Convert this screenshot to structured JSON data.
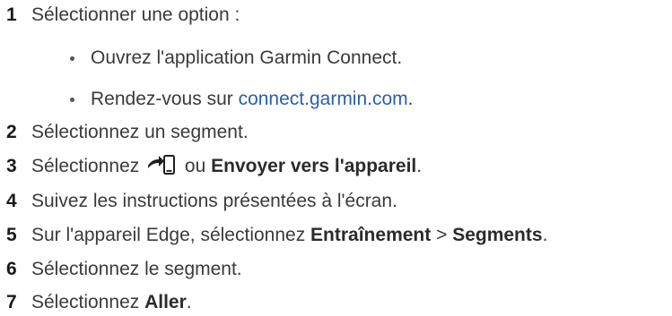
{
  "steps": {
    "s1": {
      "number": "1",
      "text": "Sélectionner une option :"
    },
    "b1": {
      "text": "Ouvrez l'application Garmin Connect."
    },
    "b2": {
      "prefix": "Rendez-vous sur ",
      "link": "connect.garmin.com",
      "suffix": "."
    },
    "s2": {
      "number": "2",
      "text": "Sélectionnez un segment."
    },
    "s3": {
      "number": "3",
      "prefix": "Sélectionnez ",
      "middle": " ou ",
      "bold": "Envoyer vers l'appareil",
      "suffix": ".",
      "icon": "send-to-device-icon"
    },
    "s4": {
      "number": "4",
      "text": "Suivez les instructions présentées à l'écran."
    },
    "s5": {
      "number": "5",
      "prefix": "Sur l'appareil Edge, sélectionnez ",
      "bold1": "Entraînement",
      "sep": " > ",
      "bold2": "Segments",
      "suffix": "."
    },
    "s6": {
      "number": "6",
      "text": "Sélectionnez le segment."
    },
    "s7": {
      "number": "7",
      "prefix": "Sélectionnez ",
      "bold": "Aller",
      "suffix": "."
    }
  },
  "colors": {
    "text": "#3a3a3a",
    "number": "#1a1a1a",
    "link": "#2a5fa8"
  }
}
